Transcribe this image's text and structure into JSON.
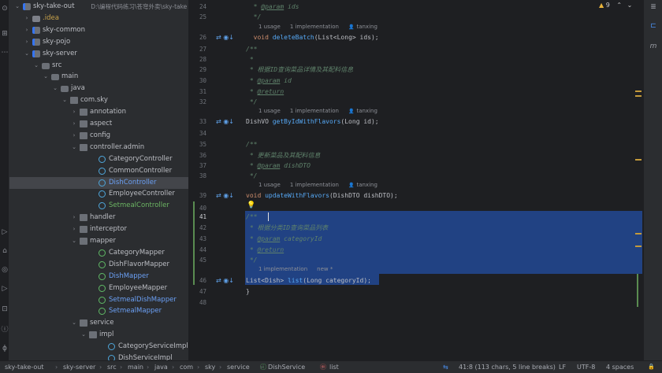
{
  "project_tree": {
    "items": [
      {
        "label": "sky-take-out",
        "path": "D:\\编程代码练习\\苍穹外卖\\sky-take",
        "icon": "module-folder-icon",
        "indent": 0,
        "open": true,
        "kind": "module"
      },
      {
        "label": ".idea",
        "icon": "folder-icon",
        "indent": 1,
        "open": false,
        "kind": "idea"
      },
      {
        "label": "sky-common",
        "icon": "module-folder-icon",
        "indent": 1,
        "open": false,
        "kind": "module"
      },
      {
        "label": "sky-pojo",
        "icon": "module-folder-icon",
        "indent": 1,
        "open": false,
        "kind": "module"
      },
      {
        "label": "sky-server",
        "icon": "module-folder-icon",
        "indent": 1,
        "open": true,
        "kind": "module"
      },
      {
        "label": "src",
        "icon": "folder-icon",
        "indent": 2,
        "open": true,
        "kind": "folder"
      },
      {
        "label": "main",
        "icon": "folder-icon",
        "indent": 3,
        "open": true,
        "kind": "folder"
      },
      {
        "label": "java",
        "icon": "folder-icon",
        "indent": 4,
        "open": true,
        "kind": "folder"
      },
      {
        "label": "com.sky",
        "icon": "package-icon",
        "indent": 5,
        "open": true,
        "kind": "pkg"
      },
      {
        "label": "annotation",
        "icon": "package-icon",
        "indent": 6,
        "open": false,
        "kind": "pkg"
      },
      {
        "label": "aspect",
        "icon": "package-icon",
        "indent": 6,
        "open": false,
        "kind": "pkg"
      },
      {
        "label": "config",
        "icon": "package-icon",
        "indent": 6,
        "open": false,
        "kind": "pkg"
      },
      {
        "label": "controller.admin",
        "icon": "package-icon",
        "indent": 6,
        "open": true,
        "kind": "pkg"
      },
      {
        "label": "CategoryController",
        "icon": "class-icon",
        "indent": 8,
        "kind": "cls"
      },
      {
        "label": "CommonController",
        "icon": "class-icon",
        "indent": 8,
        "kind": "cls"
      },
      {
        "label": "DishController",
        "icon": "class-icon",
        "indent": 8,
        "kind": "cls",
        "color": "blue",
        "selected": true
      },
      {
        "label": "EmployeeController",
        "icon": "class-icon",
        "indent": 8,
        "kind": "cls"
      },
      {
        "label": "SetmealController",
        "icon": "class-icon",
        "indent": 8,
        "kind": "cls",
        "color": "green"
      },
      {
        "label": "handler",
        "icon": "package-icon",
        "indent": 6,
        "open": false,
        "kind": "pkg"
      },
      {
        "label": "interceptor",
        "icon": "package-icon",
        "indent": 6,
        "open": false,
        "kind": "pkg"
      },
      {
        "label": "mapper",
        "icon": "package-icon",
        "indent": 6,
        "open": true,
        "kind": "pkg"
      },
      {
        "label": "CategoryMapper",
        "icon": "interface-icon",
        "indent": 8,
        "kind": "ifc"
      },
      {
        "label": "DishFlavorMapper",
        "icon": "interface-icon",
        "indent": 8,
        "kind": "ifc"
      },
      {
        "label": "DishMapper",
        "icon": "interface-icon",
        "indent": 8,
        "kind": "ifc",
        "color": "blue"
      },
      {
        "label": "EmployeeMapper",
        "icon": "interface-icon",
        "indent": 8,
        "kind": "ifc"
      },
      {
        "label": "SetmealDishMapper",
        "icon": "interface-icon",
        "indent": 8,
        "kind": "ifc",
        "color": "blue"
      },
      {
        "label": "SetmealMapper",
        "icon": "interface-icon",
        "indent": 8,
        "kind": "ifc",
        "color": "blue"
      },
      {
        "label": "service",
        "icon": "package-icon",
        "indent": 6,
        "open": true,
        "kind": "pkg"
      },
      {
        "label": "impl",
        "icon": "package-icon",
        "indent": 7,
        "open": true,
        "kind": "pkg"
      },
      {
        "label": "CategoryServiceImpl",
        "icon": "class-icon",
        "indent": 9,
        "kind": "cls"
      },
      {
        "label": "DishServiceImpl",
        "icon": "class-icon",
        "indent": 9,
        "kind": "cls"
      }
    ]
  },
  "editor": {
    "lines": [
      {
        "no": "24",
        "html": "  <span class='cm'>* </span><span class='tag'>@param</span><span class='pn'> ids</span>"
      },
      {
        "no": "25",
        "html": "  <span class='cm'>*/</span>"
      },
      {
        "no": "26",
        "html": "  <span class='kw'>void</span> <span class='fn'>deleteBatch</span>(List&lt;Long&gt; ids);",
        "gutter": "⇄ ◉↓"
      },
      {
        "no": "27",
        "html": "<span class='cm'>/**</span>"
      },
      {
        "no": "28",
        "html": "<span class='cm'> *</span>"
      },
      {
        "no": "29",
        "html": "<span class='cm'> * 根据ID查询菜品详情及其配料信息</span>"
      },
      {
        "no": "30",
        "html": "<span class='cm'> * </span><span class='tag'>@param</span><span class='pn'> id</span>"
      },
      {
        "no": "31",
        "html": "<span class='cm'> * </span><span class='tag'>@return</span>"
      },
      {
        "no": "32",
        "html": "<span class='cm'> */</span>"
      },
      {
        "no": "33",
        "html": "DishVO <span class='fn'>getByIdWithFlavors</span>(Long id);",
        "gutter": "⇄ ◉↓"
      },
      {
        "no": "34",
        "html": ""
      },
      {
        "no": "35",
        "html": "<span class='cm'>/**</span>"
      },
      {
        "no": "36",
        "html": "<span class='cm'> * 更新菜品及其配料信息</span>"
      },
      {
        "no": "37",
        "html": "<span class='cm'> * </span><span class='tag'>@param</span><span class='pn'> dishDTO</span>"
      },
      {
        "no": "38",
        "html": "<span class='cm'> */</span>"
      },
      {
        "no": "39",
        "html": "<span class='kw'>void</span> <span class='fn'>updateWithFlavors</span>(DishDTO dishDTO);",
        "gutter": "⇄ ◉↓"
      },
      {
        "no": "40",
        "html": ""
      },
      {
        "no": "41",
        "html": "<span class='cm'>/**</span>"
      },
      {
        "no": "42",
        "html": "<span class='cm'> * 根据分类ID查询菜品列表</span>"
      },
      {
        "no": "43",
        "html": "<span class='cm'> * </span><span class='tag'>@param</span><span class='pn'> categoryId</span>"
      },
      {
        "no": "44",
        "html": "<span class='cm'> * </span><span class='tag'>@return</span>"
      },
      {
        "no": "45",
        "html": "<span class='cm'> */</span>"
      },
      {
        "no": "46",
        "html": "List&lt;Dish&gt; <span class='fn'>list</span>(Long categoryId);",
        "gutter": "⇄ ◉↓"
      },
      {
        "no": "47",
        "html": "}"
      },
      {
        "no": "48",
        "html": ""
      }
    ],
    "hints": [
      {
        "usage": "1 usage",
        "impl": "1 implementation",
        "author": "tanxing"
      },
      {
        "usage": "1 usage",
        "impl": "1 implementation",
        "author": "tanxing"
      },
      {
        "usage": "1 usage",
        "impl": "1 implementation",
        "author": "tanxing"
      },
      {
        "usage": "",
        "impl": "1 implementation",
        "author": "new *"
      }
    ],
    "warnings_count": "9"
  },
  "statusbar": {
    "breadcrumbs": [
      "sky-take-out",
      "sky-server",
      "src",
      "main",
      "java",
      "com",
      "sky",
      "service",
      "DishService",
      "list"
    ],
    "position": "41:8 (113 chars, 5 line breaks)",
    "line_ending": "LF",
    "encoding": "UTF-8",
    "indent": "4 spaces"
  }
}
